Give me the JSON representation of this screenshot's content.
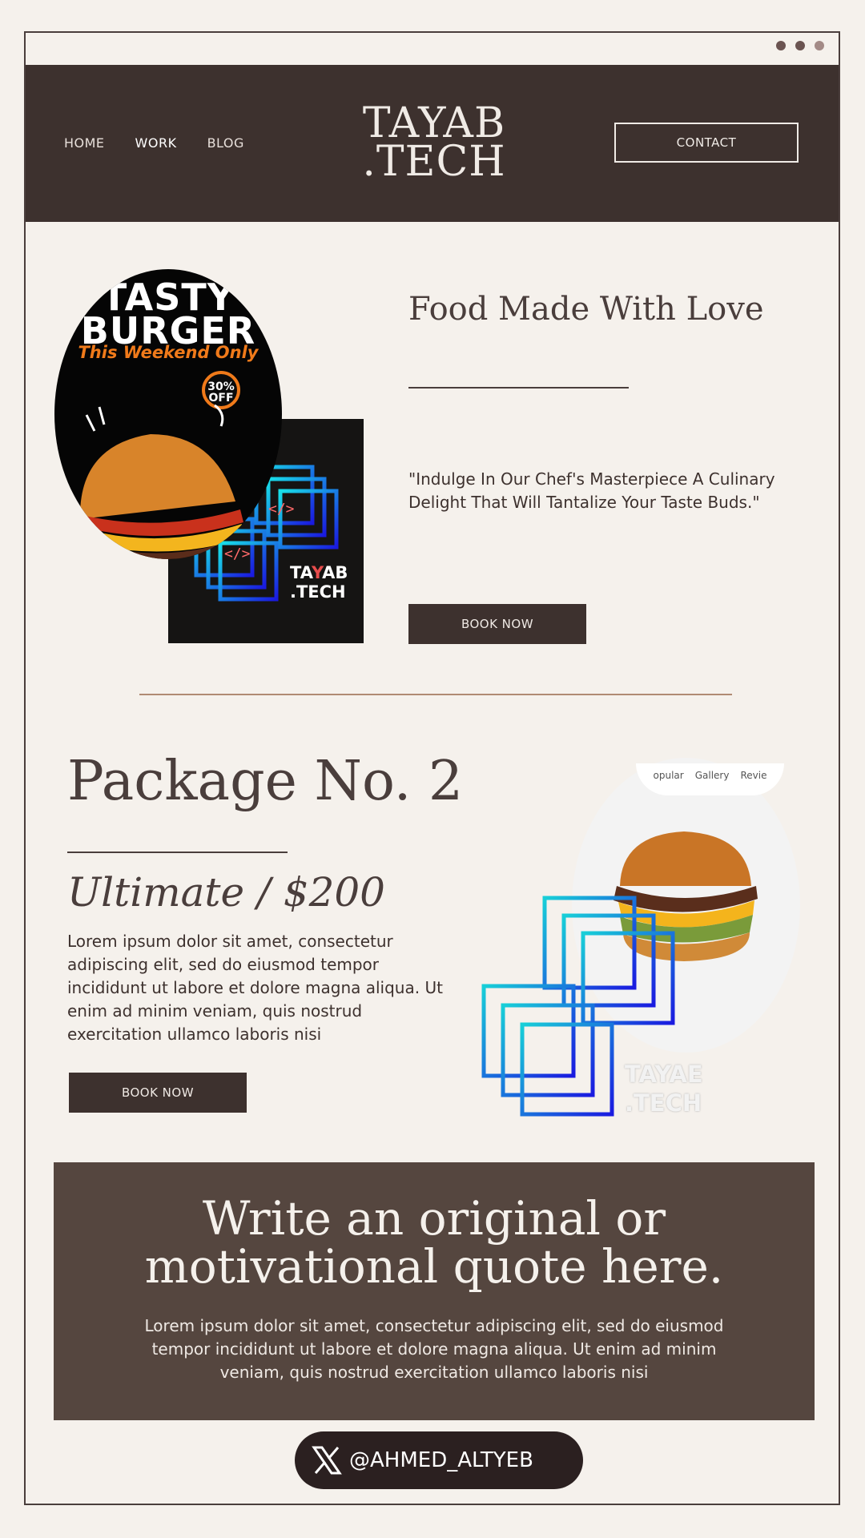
{
  "colors": {
    "page_bg": "#f5f1ec",
    "header_bg": "#3d312e",
    "quote_bg": "#55463f",
    "accent_rule": "#b08a73",
    "promo_orange": "#f07a1a"
  },
  "window": {
    "dots": [
      "#6b5451",
      "#6b5451",
      "#a38a86"
    ]
  },
  "header": {
    "nav": [
      "HOME",
      "WORK",
      "BLOG"
    ],
    "active_nav": "WORK",
    "logo_line1": "TAYAB",
    "logo_line2": ".TECH",
    "contact_label": "CONTACT"
  },
  "section1": {
    "promo": {
      "line1": "TASTY",
      "line2": "BURGER",
      "subline": "This Weekend Only",
      "badge_line1": "30%",
      "badge_line2": "OFF"
    },
    "card_logo": {
      "part1": "TA",
      "part2": "Y",
      "part3": "AB",
      "line2": ".TECH"
    },
    "title": "Food Made With Love",
    "quote": "\"Indulge In Our Chef's Masterpiece A Culinary Delight That Will Tantalize Your Taste Buds.\"",
    "button": "BOOK NOW"
  },
  "section2": {
    "title": "Package No. 2",
    "subtitle": "Ultimate / $200",
    "body": "Lorem ipsum dolor sit amet, consectetur adipiscing elit, sed do eiusmod tempor incididunt ut labore et dolore magna aliqua. Ut enim ad minim veniam, quis nostrud exercitation ullamco laboris nisi",
    "button": "BOOK NOW",
    "tabs": [
      "opular",
      "Gallery",
      "Revie"
    ],
    "card_logo": {
      "line1": "TAYAE",
      "line2": ".TECH"
    }
  },
  "quote_block": {
    "title_line1": "Write an original or",
    "title_line2": "motivational quote here.",
    "body": "Lorem ipsum dolor sit amet, consectetur adipiscing elit, sed do eiusmod tempor incididunt ut labore et dolore magna aliqua. Ut enim ad minim veniam, quis nostrud exercitation ullamco laboris nisi"
  },
  "social": {
    "icon": "x-logo-icon",
    "handle": "@AHMED_ALTYEB"
  }
}
